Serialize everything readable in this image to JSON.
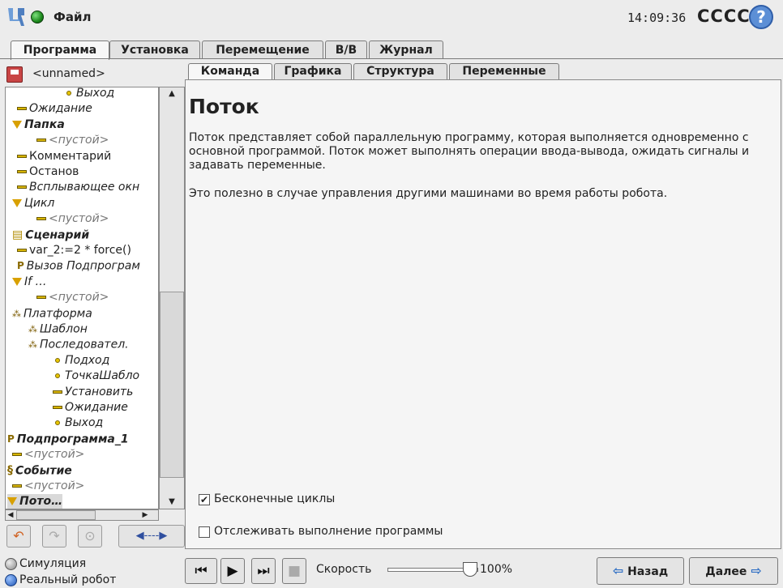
{
  "topbar": {
    "file_menu": "Файл",
    "time": "14:09:36",
    "robot_name": "CCCC",
    "help": "?"
  },
  "main_tabs": [
    "Программа",
    "Установка",
    "Перемещение",
    "В/В",
    "Журнал"
  ],
  "program": {
    "name": "<unnamed>"
  },
  "tree": [
    {
      "label": "Выход",
      "style": "i",
      "glyph": "dot"
    },
    {
      "label": "Ожидание",
      "style": "i",
      "glyph": "dash"
    },
    {
      "label": "Папка",
      "style": "bi",
      "glyph": "tri"
    },
    {
      "label": "<пустой>",
      "style": "g",
      "glyph": "dash"
    },
    {
      "label": "Комментарий",
      "style": "n",
      "glyph": "dash"
    },
    {
      "label": "Останов",
      "style": "n",
      "glyph": "dash"
    },
    {
      "label": "Всплывающее окн",
      "style": "i",
      "glyph": "dash"
    },
    {
      "label": "Цикл",
      "style": "i",
      "glyph": "tri"
    },
    {
      "label": "<пустой>",
      "style": "g",
      "glyph": "dash"
    },
    {
      "label": "Сценарий",
      "style": "bi",
      "glyph": "script"
    },
    {
      "label": "var_2:=2 * force()",
      "style": "n",
      "glyph": "dash"
    },
    {
      "label": "Вызов Подпрограм",
      "style": "i",
      "glyph": "p"
    },
    {
      "label": "If …",
      "style": "i",
      "glyph": "tri"
    },
    {
      "label": "<пустой>",
      "style": "g",
      "glyph": "dash"
    },
    {
      "label": "Платформа",
      "style": "i",
      "glyph": "pal"
    },
    {
      "label": "Шаблон",
      "style": "i",
      "glyph": "pal"
    },
    {
      "label": "Последовател.",
      "style": "i",
      "glyph": "pal"
    },
    {
      "label": "Подход",
      "style": "i",
      "glyph": "dot"
    },
    {
      "label": "ТочкаШабло",
      "style": "i",
      "glyph": "dot"
    },
    {
      "label": "Установить",
      "style": "i",
      "glyph": "dash"
    },
    {
      "label": "Ожидание",
      "style": "i",
      "glyph": "dash"
    },
    {
      "label": "Выход",
      "style": "i",
      "glyph": "dot"
    },
    {
      "label": "Подпрограмма_1",
      "style": "bi",
      "glyph": "p"
    },
    {
      "label": "<пустой>",
      "style": "g",
      "glyph": "dash"
    },
    {
      "label": "Событие",
      "style": "bi",
      "glyph": "ev"
    },
    {
      "label": "<пустой>",
      "style": "g",
      "glyph": "dash"
    },
    {
      "label": "Пото…",
      "style": "bi",
      "glyph": "tri",
      "selected": true
    }
  ],
  "sub_tabs": [
    "Команда",
    "Графика",
    "Структура",
    "Переменные"
  ],
  "node": {
    "title": "Поток",
    "description_1": "Поток представляет собой параллельную программу, которая выполняется одновременно с основной программой. Поток может выполнять операции ввода-вывода, ожидать сигналы и задавать переменные.",
    "description_2": "Это полезно в случае управления другими машинами во время работы робота.",
    "option_loops_label": "Бесконечные циклы",
    "option_loops_checked": true,
    "option_track_label": "Отслеживать выполнение программы",
    "option_track_checked": false
  },
  "footer": {
    "mode_simulation": "Симуляция",
    "mode_real": "Реальный робот",
    "speed_label": "Скорость",
    "speed_value": "100%",
    "speed_fraction": 1.0,
    "back_label": "Назад",
    "next_label": "Далее"
  },
  "colors": {
    "accent_blue": "#2f6fc4",
    "status_green": "#1d8a1d",
    "tree_yellow": "#d8b500"
  }
}
